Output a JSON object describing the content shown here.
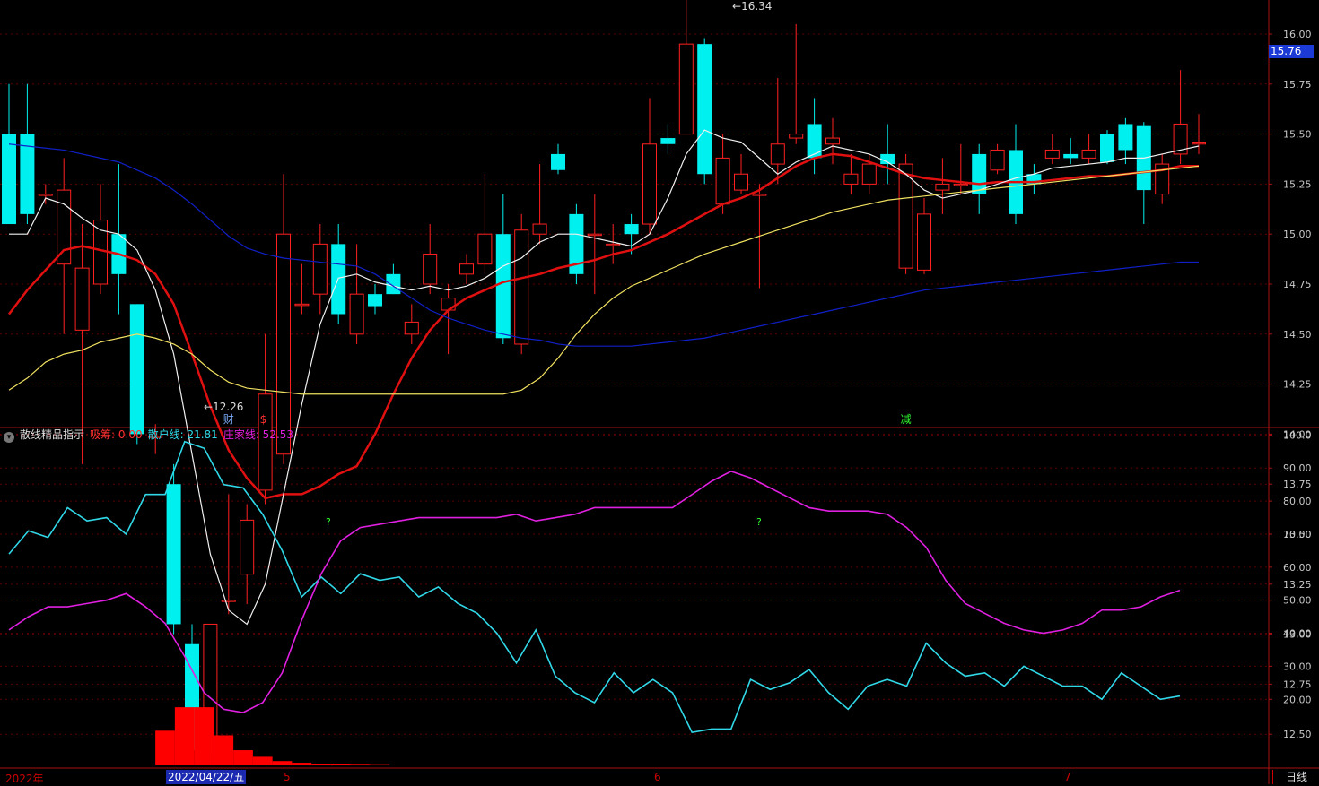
{
  "chart_data": {
    "type": "candlestick",
    "price_axis": {
      "ticks": [
        "16.00",
        "15.75",
        "15.50",
        "15.25",
        "15.00",
        "14.75",
        "14.50",
        "14.25",
        "14.00",
        "13.75",
        "13.50",
        "13.25",
        "13.00",
        "12.75",
        "12.50"
      ],
      "ylim": [
        12.0,
        16.6
      ]
    },
    "last_price": "15.76",
    "high_marker": "16.34",
    "low_marker": "12.26",
    "candles": [
      [
        15.5,
        15.05,
        15.75,
        15.05
      ],
      [
        15.5,
        15.1,
        15.75,
        15.05
      ],
      [
        15.2,
        15.2,
        15.25,
        15.15
      ],
      [
        14.85,
        15.22,
        15.38,
        14.5
      ],
      [
        14.52,
        14.83,
        15.05,
        13.85
      ],
      [
        14.75,
        15.07,
        15.25,
        14.7
      ],
      [
        15.0,
        14.8,
        15.35,
        14.6
      ],
      [
        14.65,
        14.0,
        14.65,
        13.95
      ],
      [
        13.99,
        13.99,
        14.05,
        13.9
      ],
      [
        13.75,
        13.05,
        13.85,
        13.0
      ],
      [
        12.95,
        12.42,
        13.05,
        12.35
      ],
      [
        12.4,
        13.05,
        13.05,
        12.4
      ],
      [
        13.17,
        13.17,
        13.7,
        13.1
      ],
      [
        13.3,
        13.57,
        13.65,
        13.15
      ],
      [
        13.72,
        14.2,
        14.5,
        13.65
      ],
      [
        13.9,
        15.0,
        15.3,
        13.85
      ],
      [
        14.65,
        14.65,
        14.85,
        14.6
      ],
      [
        14.7,
        14.95,
        15.05,
        14.6
      ],
      [
        14.95,
        14.6,
        15.05,
        14.55
      ],
      [
        14.5,
        14.7,
        14.95,
        14.45
      ],
      [
        14.7,
        14.64,
        14.75,
        14.6
      ],
      [
        14.8,
        14.7,
        14.85,
        14.7
      ],
      [
        14.5,
        14.56,
        14.65,
        14.45
      ],
      [
        14.75,
        14.9,
        15.05,
        14.7
      ],
      [
        14.62,
        14.68,
        14.75,
        14.4
      ],
      [
        14.8,
        14.85,
        14.9,
        14.75
      ],
      [
        14.85,
        15.0,
        15.3,
        14.8
      ],
      [
        15.0,
        14.48,
        15.2,
        14.45
      ],
      [
        14.45,
        15.02,
        15.1,
        14.4
      ],
      [
        15.0,
        15.05,
        15.35,
        14.95
      ],
      [
        15.4,
        15.32,
        15.45,
        15.3
      ],
      [
        15.1,
        14.8,
        15.15,
        14.75
      ],
      [
        15.0,
        15.0,
        15.2,
        14.7
      ],
      [
        14.95,
        14.95,
        15.05,
        14.85
      ],
      [
        15.05,
        15.0,
        15.1,
        14.9
      ],
      [
        15.05,
        15.45,
        15.68,
        15.0
      ],
      [
        15.48,
        15.45,
        15.55,
        15.4
      ],
      [
        15.5,
        15.95,
        16.34,
        15.5
      ],
      [
        15.95,
        15.3,
        15.98,
        15.25
      ],
      [
        15.15,
        15.38,
        15.5,
        15.1
      ],
      [
        15.22,
        15.3,
        15.4,
        15.2
      ],
      [
        15.2,
        15.2,
        15.25,
        14.73
      ],
      [
        15.35,
        15.45,
        15.78,
        15.25
      ],
      [
        15.48,
        15.5,
        16.05,
        15.45
      ],
      [
        15.55,
        15.38,
        15.68,
        15.3
      ],
      [
        15.45,
        15.48,
        15.58,
        15.35
      ],
      [
        15.25,
        15.3,
        15.4,
        15.2
      ],
      [
        15.25,
        15.35,
        15.4,
        15.2
      ],
      [
        15.4,
        15.35,
        15.55,
        15.25
      ],
      [
        14.83,
        15.35,
        15.4,
        14.8
      ],
      [
        14.82,
        15.1,
        15.18,
        14.8
      ],
      [
        15.22,
        15.25,
        15.38,
        15.1
      ],
      [
        15.25,
        15.25,
        15.45,
        15.2
      ],
      [
        15.4,
        15.2,
        15.45,
        15.1
      ],
      [
        15.32,
        15.42,
        15.45,
        15.3
      ],
      [
        15.42,
        15.1,
        15.55,
        15.05
      ],
      [
        15.3,
        15.25,
        15.35,
        15.2
      ],
      [
        15.38,
        15.42,
        15.5,
        15.35
      ],
      [
        15.4,
        15.38,
        15.48,
        15.35
      ],
      [
        15.38,
        15.42,
        15.5,
        15.35
      ],
      [
        15.5,
        15.36,
        15.52,
        15.35
      ],
      [
        15.55,
        15.42,
        15.58,
        15.35
      ],
      [
        15.54,
        15.22,
        15.56,
        15.05
      ],
      [
        15.2,
        15.35,
        15.4,
        15.15
      ],
      [
        15.4,
        15.55,
        15.82,
        15.35
      ],
      [
        15.45,
        15.46,
        15.6,
        15.4
      ]
    ],
    "overlay_lines": [
      {
        "color": "#e01010",
        "values": [
          14.6,
          14.72,
          14.82,
          14.92,
          14.94,
          14.92,
          14.9,
          14.87,
          14.8,
          14.65,
          14.4,
          14.14,
          13.92,
          13.78,
          13.68,
          13.7,
          13.7,
          13.74,
          13.8,
          13.84,
          14.0,
          14.2,
          14.38,
          14.52,
          14.62,
          14.68,
          14.72,
          14.76,
          14.78,
          14.8,
          14.83,
          14.85,
          14.87,
          14.9,
          14.92,
          14.96,
          15.0,
          15.05,
          15.1,
          15.15,
          15.18,
          15.22,
          15.28,
          15.34,
          15.38,
          15.4,
          15.39,
          15.36,
          15.33,
          15.3,
          15.28,
          15.27,
          15.26,
          15.25,
          15.26,
          15.26,
          15.26,
          15.27,
          15.28,
          15.29,
          15.29,
          15.3,
          15.31,
          15.32,
          15.34,
          15.34
        ]
      },
      {
        "color": "#f0f0f0",
        "values": [
          15.0,
          15.0,
          15.18,
          15.15,
          15.08,
          15.02,
          15.0,
          14.92,
          14.72,
          14.4,
          13.9,
          13.4,
          13.12,
          13.05,
          13.25,
          13.7,
          14.15,
          14.55,
          14.78,
          14.8,
          14.76,
          14.74,
          14.72,
          14.74,
          14.72,
          14.74,
          14.78,
          14.84,
          14.88,
          14.96,
          15.0,
          15.0,
          14.98,
          14.96,
          14.94,
          15.0,
          15.18,
          15.4,
          15.52,
          15.48,
          15.46,
          15.38,
          15.3,
          15.36,
          15.4,
          15.44,
          15.42,
          15.4,
          15.36,
          15.3,
          15.22,
          15.18,
          15.2,
          15.22,
          15.25,
          15.28,
          15.3,
          15.33,
          15.34,
          15.35,
          15.36,
          15.38,
          15.38,
          15.4,
          15.42,
          15.44
        ]
      },
      {
        "color": "#f0e060",
        "values": [
          14.22,
          14.28,
          14.36,
          14.4,
          14.42,
          14.46,
          14.48,
          14.5,
          14.48,
          14.45,
          14.4,
          14.32,
          14.26,
          14.23,
          14.22,
          14.21,
          14.2,
          14.2,
          14.2,
          14.2,
          14.2,
          14.2,
          14.2,
          14.2,
          14.2,
          14.2,
          14.2,
          14.2,
          14.22,
          14.28,
          14.38,
          14.5,
          14.6,
          14.68,
          14.74,
          14.78,
          14.82,
          14.86,
          14.9,
          14.93,
          14.96,
          14.99,
          15.02,
          15.05,
          15.08,
          15.11,
          15.13,
          15.15,
          15.17,
          15.18,
          15.19,
          15.2,
          15.21,
          15.22,
          15.23,
          15.24,
          15.25,
          15.26,
          15.27,
          15.28,
          15.29,
          15.3,
          15.31,
          15.32,
          15.33,
          15.34
        ]
      },
      {
        "color": "#1020c8",
        "values": [
          15.45,
          15.44,
          15.43,
          15.42,
          15.4,
          15.38,
          15.36,
          15.32,
          15.28,
          15.22,
          15.15,
          15.07,
          14.99,
          14.93,
          14.9,
          14.88,
          14.87,
          14.86,
          14.85,
          14.84,
          14.8,
          14.74,
          14.68,
          14.62,
          14.58,
          14.55,
          14.52,
          14.5,
          14.48,
          14.47,
          14.45,
          14.44,
          14.44,
          14.44,
          14.44,
          14.45,
          14.46,
          14.47,
          14.48,
          14.5,
          14.52,
          14.54,
          14.56,
          14.58,
          14.6,
          14.62,
          14.64,
          14.66,
          14.68,
          14.7,
          14.72,
          14.73,
          14.74,
          14.75,
          14.76,
          14.77,
          14.78,
          14.79,
          14.8,
          14.81,
          14.82,
          14.83,
          14.84,
          14.85,
          14.86,
          14.86
        ]
      }
    ],
    "markers": [
      {
        "text": "财",
        "color": "#7fb0ff",
        "index": 12
      },
      {
        "text": "$",
        "color": "#ff3030",
        "index": 14
      },
      {
        "text": "减",
        "color": "#30ff30",
        "index": 49
      }
    ],
    "indicator": {
      "name": "散线精品指示",
      "xishou_label": "吸筹: ",
      "xishou_value": "0.00",
      "sanhu_label": "散户线: ",
      "sanhu_value": "21.81",
      "zhuangjia_label": "庄家线: ",
      "zhuangjia_value": "52.53",
      "axis_ticks": [
        "100.0",
        "90.00",
        "80.00",
        "70.00",
        "60.00",
        "50.00",
        "40.00",
        "30.00",
        "20.00"
      ],
      "ylim": [
        0,
        102
      ],
      "sanhu_line": [
        64,
        71,
        69,
        78,
        74,
        75,
        70,
        82,
        82,
        98,
        96,
        85,
        84,
        76,
        65,
        51,
        57,
        52,
        58,
        56,
        57,
        51,
        54,
        49,
        46,
        40,
        31,
        41,
        27,
        22,
        19,
        28,
        22,
        26,
        22,
        10,
        11,
        11,
        26,
        23,
        25,
        29,
        22,
        17,
        24,
        26,
        24,
        37,
        31,
        27,
        28,
        24,
        30,
        27,
        24,
        24,
        20,
        28,
        24,
        20,
        21
      ],
      "zhuangjia_line": [
        41,
        45,
        48,
        48,
        49,
        50,
        52,
        48,
        43,
        33,
        22,
        17,
        16,
        19,
        28,
        44,
        58,
        68,
        72,
        73,
        74,
        75,
        75,
        75,
        75,
        75,
        76,
        74,
        75,
        76,
        78,
        78,
        78,
        78,
        78,
        82,
        86,
        89,
        87,
        84,
        81,
        78,
        77,
        77,
        77,
        76,
        72,
        66,
        56,
        49,
        46,
        43,
        41,
        40,
        41,
        43,
        47,
        47,
        48,
        51,
        53
      ],
      "xishou_bars": [
        0,
        0,
        0,
        0,
        0,
        0,
        0,
        0,
        10.5,
        17.6,
        17.6,
        9.1,
        4.6,
        2.6,
        1.3,
        0.8,
        0.5,
        0.3,
        0.2,
        0.1,
        0,
        0,
        0,
        0,
        0,
        0,
        0,
        0,
        0,
        0,
        0,
        0,
        0,
        0,
        0,
        0,
        0,
        0,
        0,
        0,
        0,
        0,
        0,
        0,
        0,
        0,
        0,
        0,
        0,
        0,
        0,
        0,
        0,
        0,
        0,
        0,
        0,
        0,
        0,
        0,
        0
      ],
      "question_marks": [
        "?",
        "?"
      ]
    },
    "date_axis": {
      "labels": [
        "2022年",
        "5",
        "6",
        "7"
      ],
      "selected_date": "2022/04/22/五"
    }
  },
  "ui": {
    "period_label": "日线",
    "toggle_glyph": "▾"
  },
  "colors": {
    "up": "#ff2020",
    "down": "#00f0f0",
    "grid": "#5a0000",
    "axis": "#aa1010",
    "text": "#c8c8c8",
    "sanhu": "#30d8e8",
    "zhuangjia": "#e020e0",
    "xishou": "#ff0000"
  }
}
